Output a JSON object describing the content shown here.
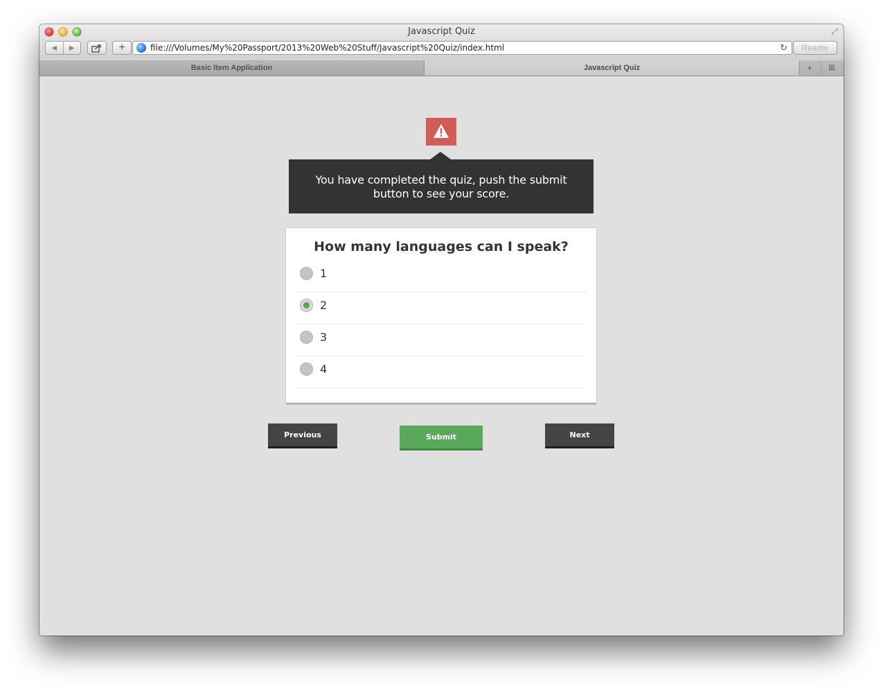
{
  "window": {
    "title": "Javascript Quiz",
    "url": "file:///Volumes/My%20Passport/2013%20Web%20Stuff/Javascript%20Quiz/index.html",
    "reader_label": "Reader",
    "icons": {
      "back": "◀",
      "forward": "▶",
      "share": "share-icon",
      "add_tab": "+",
      "reload": "↻",
      "fullscreen": "⤢",
      "tab_add": "+",
      "tab_overview": "▥"
    }
  },
  "tabs": [
    {
      "label": "Basic Item Application",
      "active": false
    },
    {
      "label": "Javascript Quiz",
      "active": true
    }
  ],
  "alert": {
    "icon": "warning-icon",
    "message": "You have completed the quiz, push the submit button to see your score."
  },
  "quiz": {
    "question": "How many languages can I speak?",
    "answers": [
      {
        "label": "1",
        "selected": false
      },
      {
        "label": "2",
        "selected": true
      },
      {
        "label": "3",
        "selected": false
      },
      {
        "label": "4",
        "selected": false
      }
    ]
  },
  "buttons": {
    "previous": "Previous",
    "submit": "Submit",
    "next": "Next"
  },
  "colors": {
    "alert_red": "#d35b58",
    "tooltip_bg": "#333333",
    "submit_green": "#5aa85c",
    "dark_button": "#444444",
    "page_bg": "#e0e0e0"
  }
}
